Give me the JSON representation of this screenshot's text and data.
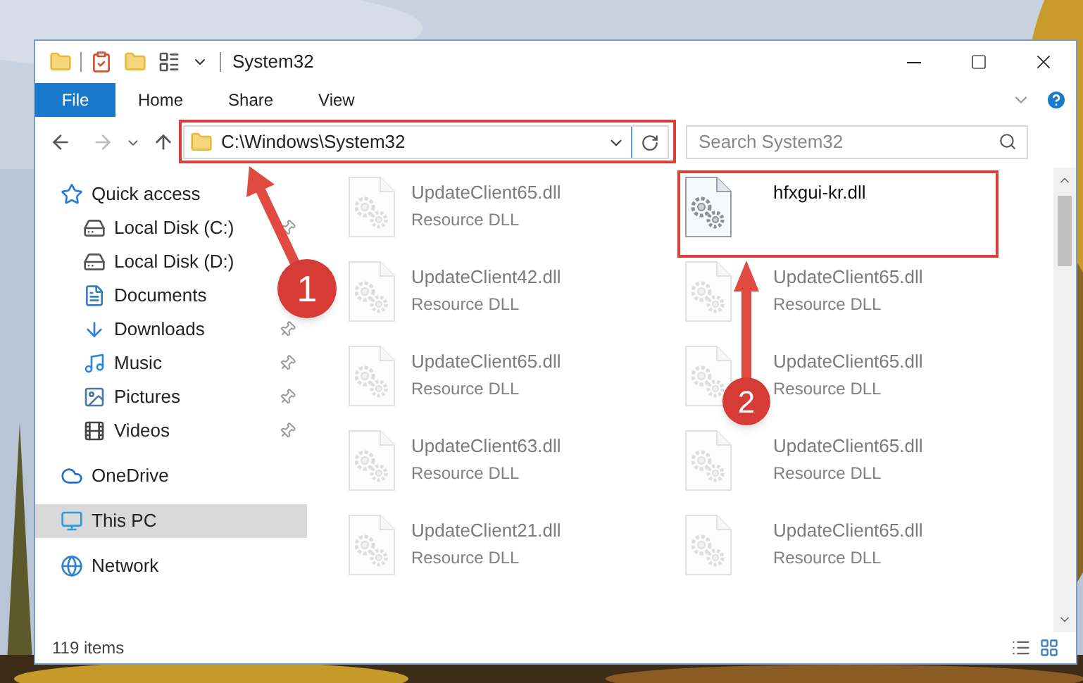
{
  "window": {
    "title": "System32"
  },
  "ribbon": {
    "tabs": [
      {
        "label": "File",
        "selected": true
      },
      {
        "label": "Home",
        "selected": false
      },
      {
        "label": "Share",
        "selected": false
      },
      {
        "label": "View",
        "selected": false
      }
    ]
  },
  "address_bar": {
    "path": "C:\\Windows\\System32"
  },
  "search": {
    "placeholder": "Search System32"
  },
  "sidebar": {
    "items": [
      {
        "label": "Quick access",
        "kind": "star",
        "selected": false,
        "children": [
          {
            "label": "Local Disk (C:)",
            "kind": "drive",
            "selected": false,
            "pinned": true
          },
          {
            "label": "Local Disk (D:)",
            "kind": "drive",
            "selected": false,
            "pinned": false
          },
          {
            "label": "Documents",
            "kind": "document",
            "selected": false,
            "pinned": false
          },
          {
            "label": "Downloads",
            "kind": "download",
            "selected": false,
            "pinned": true
          },
          {
            "label": "Music",
            "kind": "music",
            "selected": false,
            "pinned": true
          },
          {
            "label": "Pictures",
            "kind": "pictures",
            "selected": false,
            "pinned": true
          },
          {
            "label": "Videos",
            "kind": "videos",
            "selected": false,
            "pinned": true
          }
        ]
      },
      {
        "label": "OneDrive",
        "kind": "cloud",
        "selected": false
      },
      {
        "label": "This PC",
        "kind": "computer",
        "selected": true
      },
      {
        "label": "Network",
        "kind": "network",
        "selected": false
      }
    ]
  },
  "files": [
    {
      "name": "UpdateClient65.dll",
      "type": "Resource DLL",
      "blurred": true
    },
    {
      "name": "hfxgui-kr.dll",
      "blurred": false
    },
    {
      "name": "UpdateClient42.dll",
      "type": "Resource DLL",
      "blurred": true
    },
    {
      "name": "UpdateClient65.dll",
      "type": "Resource DLL",
      "blurred": true
    },
    {
      "name": "UpdateClient65.dll",
      "type": "Resource DLL",
      "blurred": true
    },
    {
      "name": "UpdateClient65.dll",
      "type": "Resource DLL",
      "blurred": true
    },
    {
      "name": "UpdateClient63.dll",
      "type": "Resource DLL",
      "blurred": true
    },
    {
      "name": "UpdateClient65.dll",
      "type": "Resource DLL",
      "blurred": true
    },
    {
      "name": "UpdateClient21.dll",
      "type": "Resource DLL",
      "blurred": true
    },
    {
      "name": "UpdateClient65.dll",
      "type": "Resource DLL",
      "blurred": true
    }
  ],
  "status_bar": {
    "item_count": "119 items"
  },
  "annotations": [
    {
      "number": "1"
    },
    {
      "number": "2"
    }
  ]
}
